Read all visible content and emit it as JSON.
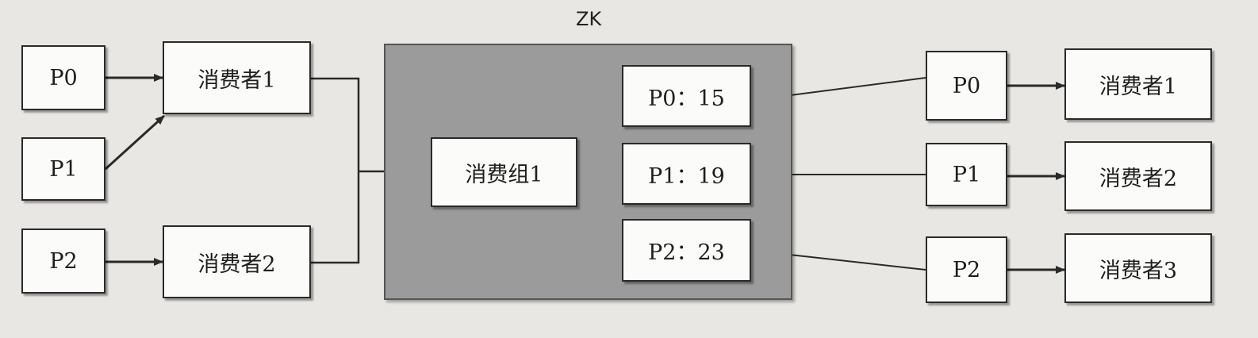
{
  "zk_title": "ZK",
  "left": {
    "partitions": [
      "P0",
      "P1",
      "P2"
    ],
    "consumers": [
      "消费者1",
      "消费者2"
    ]
  },
  "zk": {
    "group": "消费组1",
    "offsets": [
      "P0：15",
      "P1：19",
      "P2：23"
    ]
  },
  "right": {
    "partitions": [
      "P0",
      "P1",
      "P2"
    ],
    "consumers": [
      "消费者1",
      "消费者2",
      "消费者3"
    ]
  },
  "colors": {
    "background": "#e9e7e3",
    "zk_panel": "#9b9b9b",
    "box": "#fbfbf9",
    "line": "#2a2a2a"
  }
}
